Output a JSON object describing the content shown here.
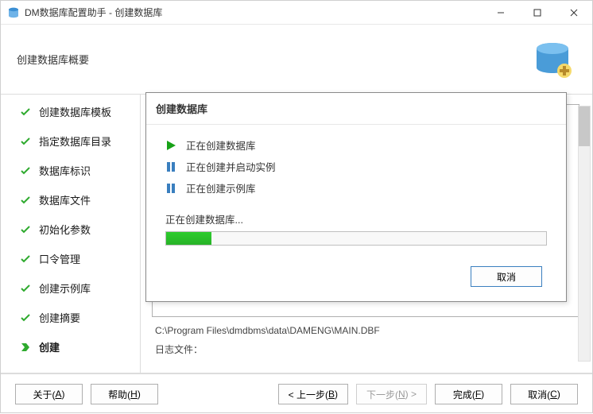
{
  "titlebar": {
    "title": "DM数据库配置助手 - 创建数据库"
  },
  "subheader": {
    "title": "创建数据库概要"
  },
  "sidebar": {
    "items": [
      {
        "label": "创建数据库模板",
        "state": "done"
      },
      {
        "label": "指定数据库目录",
        "state": "done"
      },
      {
        "label": "数据库标识",
        "state": "done"
      },
      {
        "label": "数据库文件",
        "state": "done"
      },
      {
        "label": "初始化参数",
        "state": "done"
      },
      {
        "label": "口令管理",
        "state": "done"
      },
      {
        "label": "创建示例库",
        "state": "done"
      },
      {
        "label": "创建摘要",
        "state": "done"
      },
      {
        "label": "创建",
        "state": "active"
      }
    ]
  },
  "main": {
    "path_line": "C:\\Program Files\\dmdbms\\data\\DAMENG\\MAIN.DBF",
    "log_label": "日志文件："
  },
  "modal": {
    "title": "创建数据库",
    "steps": [
      {
        "icon": "play",
        "label": "正在创建数据库"
      },
      {
        "icon": "pause",
        "label": "正在创建并启动实例"
      },
      {
        "icon": "pause",
        "label": "正在创建示例库"
      }
    ],
    "status_text": "正在创建数据库...",
    "progress_percent": 12,
    "cancel_label": "取消"
  },
  "footer": {
    "about": "关于(",
    "about_key": "A",
    "about_suffix": ")",
    "help": "帮助(",
    "help_key": "H",
    "help_suffix": ")",
    "prev_prefix": "< 上一步(",
    "prev_key": "B",
    "prev_suffix": ")",
    "next_prefix": "下一步(",
    "next_key": "N",
    "next_suffix": ") >",
    "finish": "完成(",
    "finish_key": "F",
    "finish_suffix": ")",
    "cancel": "取消(",
    "cancel_key": "C",
    "cancel_suffix": ")"
  }
}
